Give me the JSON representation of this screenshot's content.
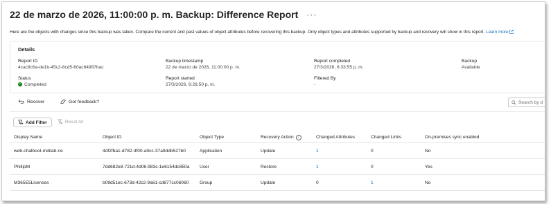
{
  "header": {
    "title": "22 de marzo de 2026, 11:00:00 p. m. Backup: Difference Report",
    "more_label": "···"
  },
  "description": {
    "text": "Here are the objects with changes since this backup was taken. Compare the current and past values of object attributes before recovering this backup. Only object types and attributes supported by backup and recovery will show in this report.",
    "link_label": "Learn more"
  },
  "details": {
    "title": "Details",
    "report_id": {
      "label": "Report ID",
      "value": "4cac9c6a-de1b-45c2-8cd5-60ac64987bac"
    },
    "backup_timestamp": {
      "label": "Backup timestamp",
      "value": "22 de marzo de 2026, 11:00:00 p. m."
    },
    "report_completed": {
      "label": "Report completed",
      "value": "27/3/2026, 6:33:55 p. m."
    },
    "backup": {
      "label": "Backup",
      "value": "Available"
    },
    "status": {
      "label": "Status",
      "value": "Completed"
    },
    "report_started": {
      "label": "Report started",
      "value": "27/3/2026, 6:26:50 p. m."
    },
    "filtered_by": {
      "label": "Filtered By",
      "value": "-"
    }
  },
  "toolbar": {
    "recover_label": "Recover",
    "feedback_label": "Got feedback?",
    "search_placeholder": "Search by d"
  },
  "filters": {
    "add_filter_label": "Add Filter",
    "reset_all_label": "Reset All"
  },
  "table": {
    "columns": [
      "Display Name",
      "Object ID",
      "Object Type",
      "Recovery Action",
      "Changed Attributes",
      "Changed Links",
      "On-premises sync enabled"
    ],
    "rows": [
      {
        "display_name": "web-chatboot-mdilab-ne",
        "object_id": "4df2fba1-d782-4f00-a9cc-37a9ddb527b0",
        "object_type": "Application",
        "recovery_action": "Update",
        "changed_attributes": "1",
        "changed_links": "0",
        "sync_enabled": "No"
      },
      {
        "display_name": "PhillipM",
        "object_id": "7dd682e8-721d-4d06-983c-1e6154dc850a",
        "object_type": "User",
        "recovery_action": "Restore",
        "changed_attributes": "1",
        "changed_links": "0",
        "sync_enabled": "Yes"
      },
      {
        "display_name": "M365E5Licenses",
        "object_id": "b09d51ec-673d-42c2-9a61-cd877cc06060",
        "object_type": "Group",
        "recovery_action": "Update",
        "changed_attributes": "0",
        "changed_links": "1",
        "sync_enabled": "No"
      }
    ]
  },
  "colors": {
    "link": "#0f6cbd",
    "status_success": "#107c10"
  }
}
